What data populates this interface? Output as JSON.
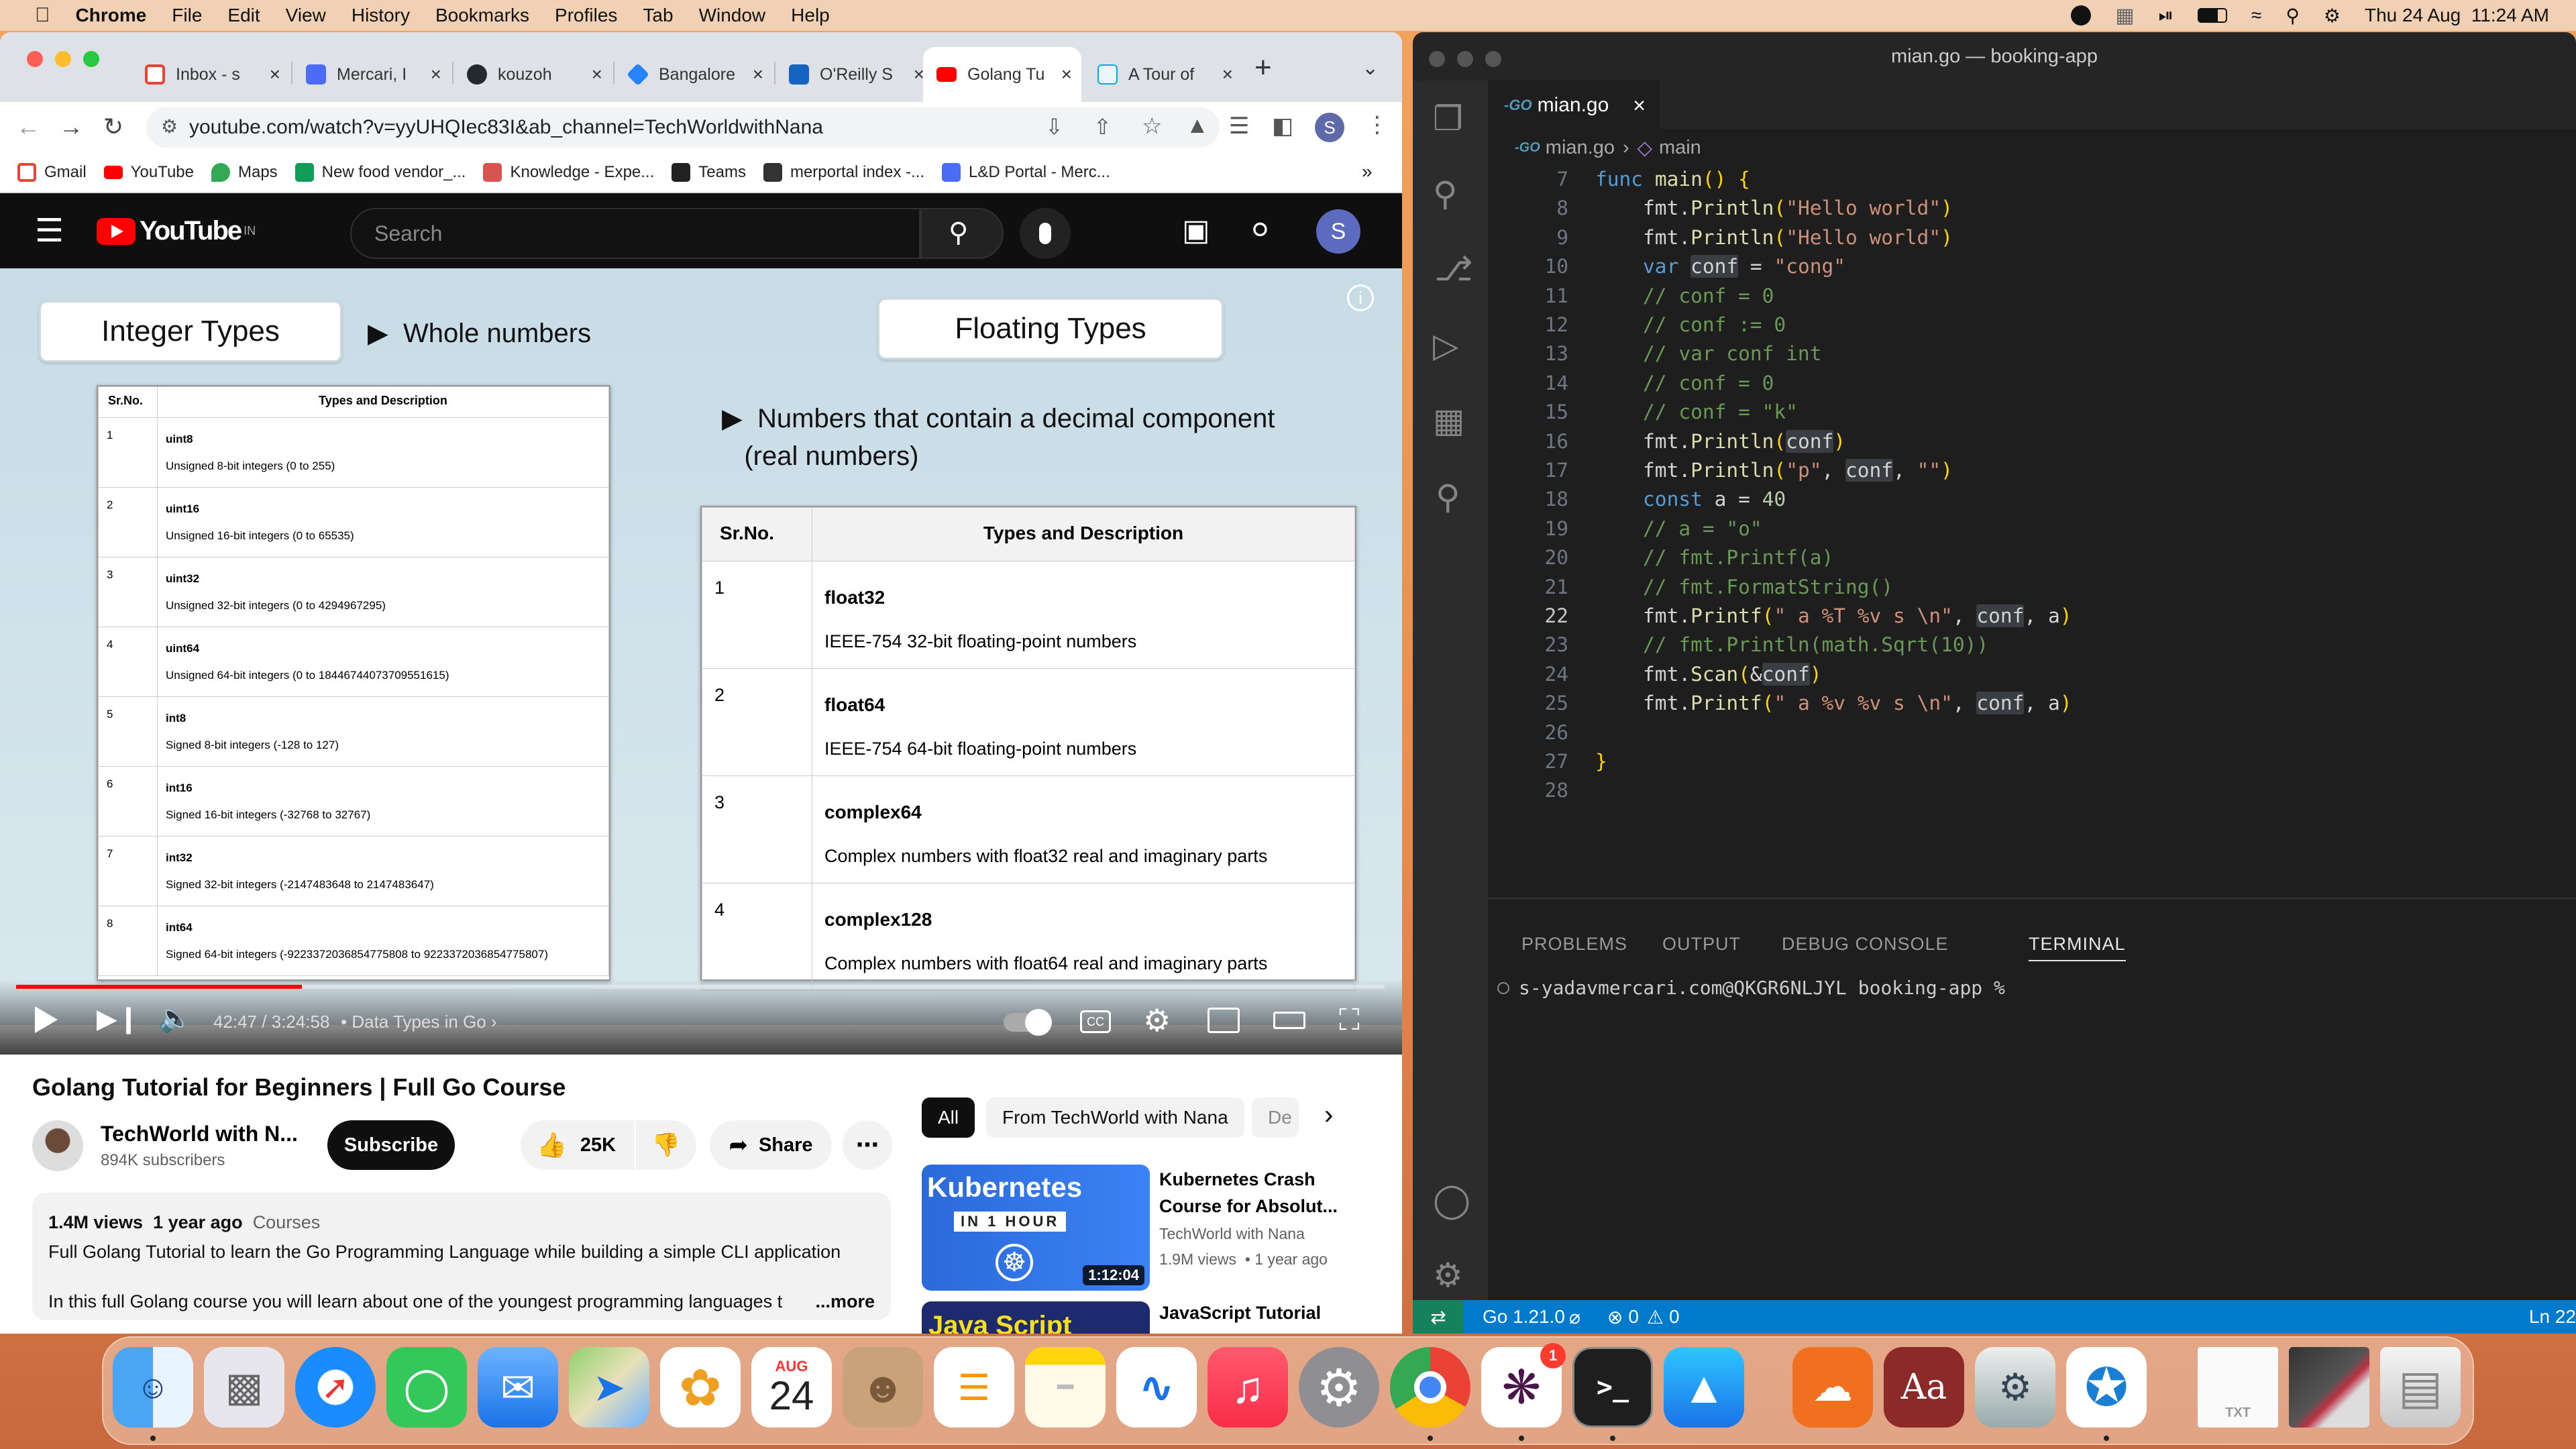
{
  "menubar": {
    "app": "Chrome",
    "items": [
      "File",
      "Edit",
      "View",
      "History",
      "Bookmarks",
      "Profiles",
      "Tab",
      "Window",
      "Help"
    ],
    "datetime": "Thu 24 Aug  11:24 AM"
  },
  "chrome": {
    "tabs": [
      {
        "label": "Inbox - s",
        "color": "#ea4335"
      },
      {
        "label": "Mercari, I",
        "color": "#4a6cf7"
      },
      {
        "label": "kouzoh",
        "color": "#24292f"
      },
      {
        "label": "Bangalore",
        "color": "#2684ff"
      },
      {
        "label": "O'Reilly S",
        "color": "#1565c0"
      },
      {
        "label": "Golang Tu",
        "color": "#ff0000"
      },
      {
        "label": "A Tour of",
        "color": "#00add8"
      }
    ],
    "url": "youtube.com/watch?v=yyUHQIec83I&ab_channel=TechWorldwithNana",
    "profile_initial": "S",
    "bookmarks": [
      {
        "label": "Gmail",
        "color": "#ea4335"
      },
      {
        "label": "YouTube",
        "color": "#ff0000"
      },
      {
        "label": "Maps",
        "color": "#34a853"
      },
      {
        "label": "New food vendor_...",
        "color": "#0f9d58"
      },
      {
        "label": "Knowledge - Expe...",
        "color": "#d9534f"
      },
      {
        "label": "Teams",
        "color": "#222"
      },
      {
        "label": "merportal index -...",
        "color": "#333"
      },
      {
        "label": "L&D Portal - Merc...",
        "color": "#4a6cf7"
      }
    ]
  },
  "youtube": {
    "logo": "YouTube",
    "region": "IN",
    "search_placeholder": "Search",
    "avatar_initial": "S",
    "slide": {
      "integer_title": "Integer Types",
      "integer_bullet": "Whole numbers",
      "float_title": "Floating Types",
      "float_bullet_1": "Numbers that contain a decimal component",
      "float_bullet_2": "(real numbers)",
      "int_table": {
        "headers": [
          "Sr.No.",
          "Types and Description"
        ],
        "rows": [
          [
            "1",
            "uint8",
            "Unsigned 8-bit integers (0 to 255)"
          ],
          [
            "2",
            "uint16",
            "Unsigned 16-bit integers (0 to 65535)"
          ],
          [
            "3",
            "uint32",
            "Unsigned 32-bit integers (0 to 4294967295)"
          ],
          [
            "4",
            "uint64",
            "Unsigned 64-bit integers (0 to 18446744073709551615)"
          ],
          [
            "5",
            "int8",
            "Signed 8-bit integers (-128 to 127)"
          ],
          [
            "6",
            "int16",
            "Signed 16-bit integers (-32768 to 32767)"
          ],
          [
            "7",
            "int32",
            "Signed 32-bit integers (-2147483648 to 2147483647)"
          ],
          [
            "8",
            "int64",
            "Signed 64-bit integers (-9223372036854775808 to 9223372036854775807)"
          ]
        ]
      },
      "float_table": {
        "headers": [
          "Sr.No.",
          "Types and Description"
        ],
        "rows": [
          [
            "1",
            "float32",
            "IEEE-754 32-bit floating-point numbers"
          ],
          [
            "2",
            "float64",
            "IEEE-754 64-bit floating-point numbers"
          ],
          [
            "3",
            "complex64",
            "Complex numbers with float32 real and imaginary parts"
          ],
          [
            "4",
            "complex128",
            "Complex numbers with float64 real and imaginary parts"
          ]
        ]
      }
    },
    "player": {
      "time": "42:47 / 3:24:58",
      "chapter": "• Data Types in Go",
      "progress_fraction": 0.209
    },
    "video_title": "Golang Tutorial for Beginners | Full Go Course",
    "channel": "TechWorld with N...",
    "subscribers": "894K subscribers",
    "subscribe": "Subscribe",
    "likes": "25K",
    "share": "Share",
    "description": {
      "views": "1.4M views",
      "age": "1 year ago",
      "tag": "Courses",
      "line1": "Full Golang Tutorial to learn the Go Programming Language while building a simple CLI application",
      "line2": "In this full Golang course you will learn about one of the youngest programming languages t",
      "more": "...more"
    },
    "chips": [
      "All",
      "From TechWorld with Nana",
      "De"
    ],
    "related": [
      {
        "title_1": "Kubernetes Crash",
        "title_2": "Course for Absolut...",
        "channel": "TechWorld with Nana",
        "meta": "1.9M views  • 1 year ago",
        "duration": "1:12:04",
        "thumb_text_1": "Kubernetes",
        "thumb_text_2": "IN 1 HOUR"
      },
      {
        "title_1": "JavaScript Tutorial",
        "thumb_text_1": "Java Script"
      }
    ]
  },
  "vscode": {
    "window_title": "mian.go — booking-app",
    "tab": "mian.go",
    "breadcrumb_file": "mian.go",
    "breadcrumb_symbol": "main",
    "code": [
      {
        "n": "7",
        "t": "func main() {"
      },
      {
        "n": "8",
        "t": "    fmt.Println(\"Hello world\")"
      },
      {
        "n": "9",
        "t": "    fmt.Println(\"Hello world\")"
      },
      {
        "n": "10",
        "t": "    var conf = \"cong\""
      },
      {
        "n": "11",
        "t": "    // conf = 0"
      },
      {
        "n": "12",
        "t": "    // conf := 0"
      },
      {
        "n": "13",
        "t": "    // var conf int"
      },
      {
        "n": "14",
        "t": "    // conf = 0"
      },
      {
        "n": "15",
        "t": "    // conf = \"k\""
      },
      {
        "n": "16",
        "t": "    fmt.Println(conf)"
      },
      {
        "n": "17",
        "t": "    fmt.Println(\"p\", conf, \"\")"
      },
      {
        "n": "18",
        "t": "    const a = 40"
      },
      {
        "n": "19",
        "t": "    // a = \"o\""
      },
      {
        "n": "20",
        "t": "    // fmt.Printf(a)"
      },
      {
        "n": "21",
        "t": "    // fmt.FormatString()"
      },
      {
        "n": "22",
        "t": "    fmt.Printf(\" a %T %v s \\n\", conf, a)"
      },
      {
        "n": "23",
        "t": "    // fmt.Println(math.Sqrt(10))"
      },
      {
        "n": "24",
        "t": "    fmt.Scan(&conf)"
      },
      {
        "n": "25",
        "t": "    fmt.Printf(\" a %v %v s \\n\", conf, a)"
      },
      {
        "n": "26",
        "t": ""
      },
      {
        "n": "27",
        "t": "}"
      },
      {
        "n": "28",
        "t": ""
      }
    ],
    "panel_tabs": [
      "PROBLEMS",
      "OUTPUT",
      "DEBUG CONSOLE",
      "TERMINAL"
    ],
    "terminal_prompt": "s-yadavmercari.com@QKGR6NLJYL booking-app %",
    "status": {
      "go": "Go 1.21.0",
      "errors": "0",
      "warnings": "0",
      "line": "Ln 22"
    }
  },
  "dock": {
    "calendar_month": "AUG",
    "calendar_day": "24",
    "slack_badge": "1"
  }
}
